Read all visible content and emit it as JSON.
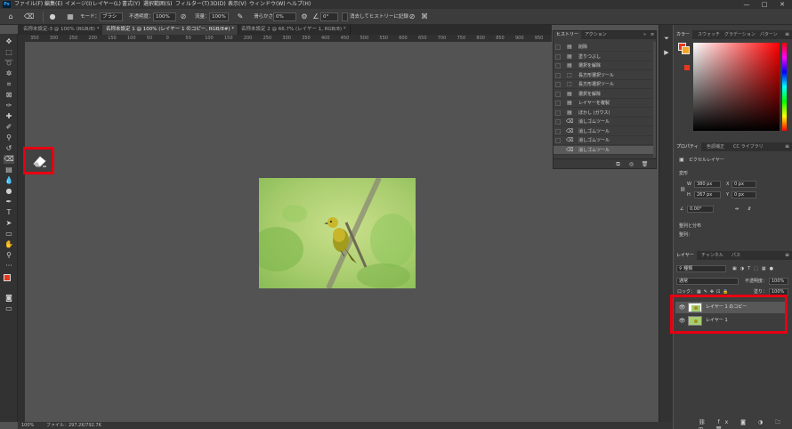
{
  "app": {
    "menu": [
      "ファイル(F)",
      "編集(E)",
      "イメージ(I)",
      "レイヤー(L)",
      "書式(Y)",
      "選択範囲(S)",
      "フィルター(T)",
      "3D(D)",
      "表示(V)",
      "ウィンドウ(W)",
      "ヘルプ(H)"
    ],
    "window_controls": [
      "—",
      "□",
      "✕"
    ]
  },
  "options_bar": {
    "mode_label": "モード：",
    "mode_value": "ブラシ",
    "opacity_label": "不透明度：",
    "opacity_value": "100%",
    "flow_label": "流量：",
    "flow_value": "100%",
    "smoothing_label": "滑らかさ：",
    "smoothing_value": "0%",
    "angle_value": "0°",
    "erase_history_label": "消去してヒストリーに記録"
  },
  "tabs": [
    {
      "label": "名称未設定-3 @ 100% (RGB/8) *",
      "active": false
    },
    {
      "label": "名称未設定 1 @ 100% (レイヤー 1 のコピー, RGB/8#) *",
      "active": true
    },
    {
      "label": "名称未設定 2 @ 66.7% (レイヤー 1, RGB/8) *",
      "active": false
    }
  ],
  "ruler_ticks": [
    "350",
    "300",
    "250",
    "200",
    "150",
    "100",
    "50",
    "0",
    "50",
    "100",
    "150",
    "200",
    "250",
    "300",
    "350",
    "400",
    "450",
    "500",
    "550",
    "600",
    "650",
    "700",
    "750",
    "800",
    "850",
    "900",
    "950"
  ],
  "status": {
    "zoom": "100%",
    "file_info": "ファイル：297.2K/792.7K"
  },
  "history_panel": {
    "tabs": [
      "ヒストリー",
      "アクション"
    ],
    "items": [
      {
        "label": "削除",
        "icon": "doc-icon"
      },
      {
        "label": "塗りつぶし",
        "icon": "doc-icon"
      },
      {
        "label": "選択を解除",
        "icon": "doc-icon"
      },
      {
        "label": "長方形選択ツール",
        "icon": "marquee-icon"
      },
      {
        "label": "長方形選択ツール",
        "icon": "marquee-icon"
      },
      {
        "label": "選択を解除",
        "icon": "doc-icon"
      },
      {
        "label": "レイヤーを複製",
        "icon": "doc-icon"
      },
      {
        "label": "ぼかし (ガウス)",
        "icon": "doc-icon"
      },
      {
        "label": "消しゴムツール",
        "icon": "eraser-icon"
      },
      {
        "label": "消しゴムツール",
        "icon": "eraser-icon"
      },
      {
        "label": "消しゴムツール",
        "icon": "eraser-icon"
      },
      {
        "label": "消しゴムツール",
        "icon": "eraser-icon",
        "active": true
      }
    ]
  },
  "color_panel": {
    "tabs": [
      "カラー",
      "スウォッチ",
      "グラデーション",
      "パターン"
    ],
    "foreground": "#e8371e",
    "background": "#f5a623"
  },
  "properties_panel": {
    "tabs": [
      "プロパティ",
      "色調補正",
      "CC ライブラリ"
    ],
    "layer_type": "ピクセルレイヤー",
    "transform_label": "変形",
    "w_label": "W",
    "w_value": "380 px",
    "h_label": "H",
    "h_value": "267 px",
    "x_label": "X",
    "x_value": "0 px",
    "y_label": "Y",
    "y_value": "0 px",
    "angle_value": "0.00°",
    "align_label": "整列と分布",
    "align_sub": "整列："
  },
  "layers_panel": {
    "tabs": [
      "レイヤー",
      "チャンネル",
      "パス"
    ],
    "filter_label": "種類",
    "blend_mode": "通常",
    "opacity_label": "不透明度：",
    "opacity_value": "100%",
    "lock_label": "ロック：",
    "fill_label": "塗り：",
    "fill_value": "100%",
    "layers": [
      {
        "name": "レイヤー 1 のコピー",
        "active": true
      },
      {
        "name": "レイヤー 1",
        "active": false
      }
    ]
  },
  "accent_highlight": "#e60012"
}
